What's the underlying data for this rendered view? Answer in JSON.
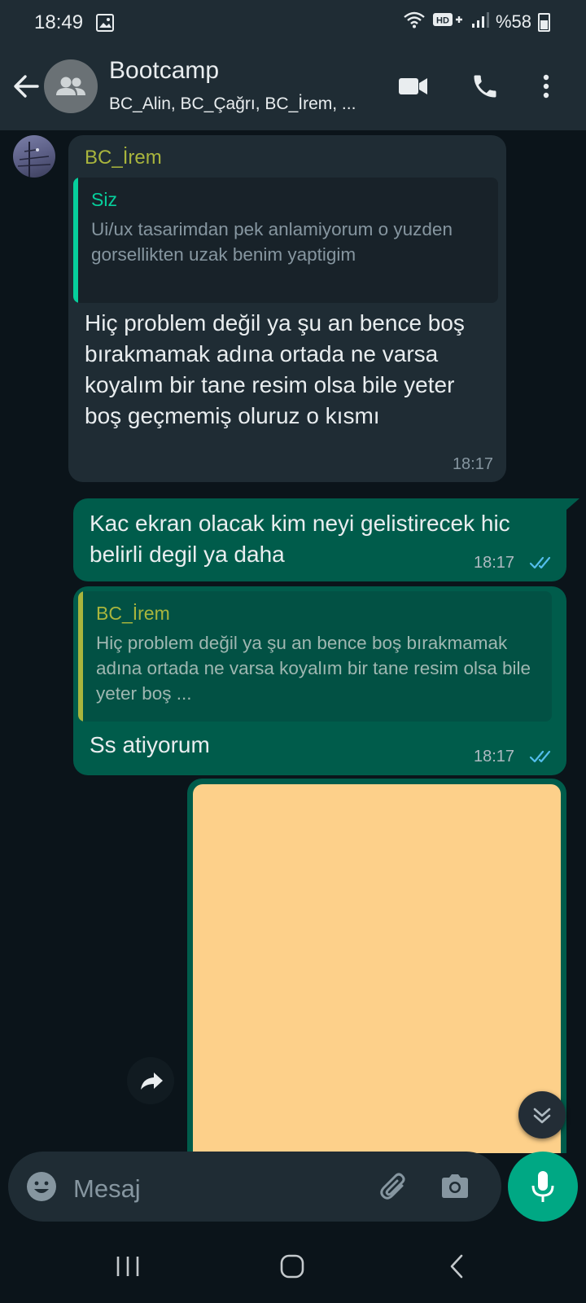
{
  "status_bar": {
    "time": "18:49",
    "battery": "%58"
  },
  "header": {
    "title": "Bootcamp",
    "subtitle": "BC_Alin, BC_Çağrı, BC_İrem, ..."
  },
  "messages": [
    {
      "sender": "BC_İrem",
      "reply_to_author": "Siz",
      "reply_to_text": "Ui/ux tasarimdan pek anlamiyorum o yuzden gorsellikten uzak benim yaptigim",
      "text": "Hiç problem değil ya şu an bence boş bırakmamak adına ortada ne varsa koyalım bir tane resim olsa bile yeter boş geçmemiş oluruz o kısmı",
      "time": "18:17"
    },
    {
      "text": "Kac ekran olacak kim neyi gelistirecek hic belirli degil ya daha",
      "time": "18:17"
    },
    {
      "reply_to_author": "BC_İrem",
      "reply_to_text": "Hiç problem değil ya şu an bence boş bırakmamak adına ortada ne varsa koyalım bir tane resim olsa bile yeter boş ...",
      "text": "Ss atiyorum",
      "time": "18:17"
    }
  ],
  "input": {
    "placeholder": "Mesaj"
  },
  "colors": {
    "background": "#0b141a",
    "bar": "#1f2c34",
    "outgoing_bubble": "#005c4b",
    "accent": "#00a884",
    "read_ticks": "#53bdeb",
    "image_fill": "#fdd08a"
  }
}
